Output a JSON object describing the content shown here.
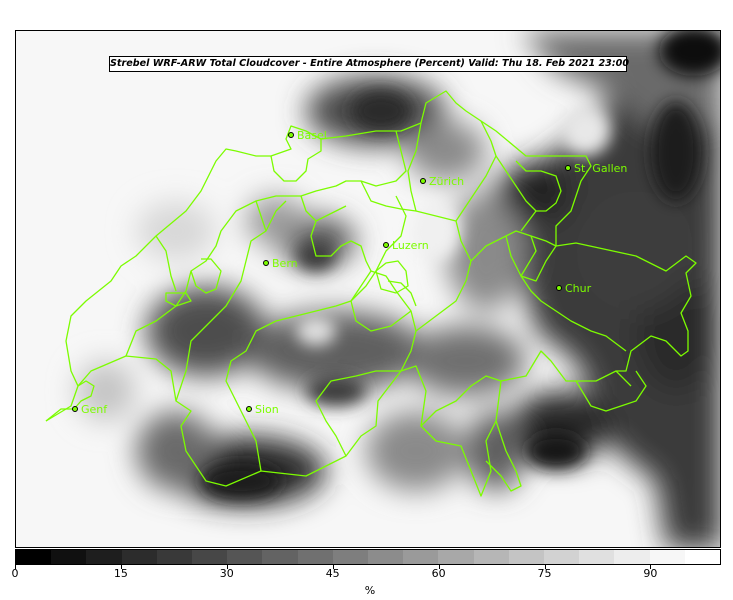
{
  "title": "Strebel WRF-ARW Total Cloudcover - Entire Atmosphere (Percent)   Valid: Thu 18. Feb 2021 23:00",
  "cities": [
    {
      "name": "Basel"
    },
    {
      "name": "Zürich"
    },
    {
      "name": "St. Gallen"
    },
    {
      "name": "Luzern"
    },
    {
      "name": "Bern"
    },
    {
      "name": "Chur"
    },
    {
      "name": "Genf"
    },
    {
      "name": "Sion"
    }
  ],
  "colorbar": {
    "min": 0,
    "max": 100,
    "step": 5,
    "ticks": [
      "0",
      "15",
      "30",
      "45",
      "60",
      "75",
      "90"
    ],
    "unit": "%",
    "colors": [
      "#000000",
      "#101010",
      "#1e1e1e",
      "#2c2c2c",
      "#393939",
      "#474747",
      "#555555",
      "#636363",
      "#707070",
      "#7e7e7e",
      "#8c8c8c",
      "#9a9a9a",
      "#a8a8a8",
      "#b6b6b6",
      "#c4c4c4",
      "#d2d2d2",
      "#e0e0e0",
      "#ededed",
      "#f7f7f7",
      "#ffffff"
    ]
  },
  "style": {
    "border_color": "#7cfc00",
    "label_color": "#7cfc00",
    "marker_fill": "#7cfc00"
  }
}
